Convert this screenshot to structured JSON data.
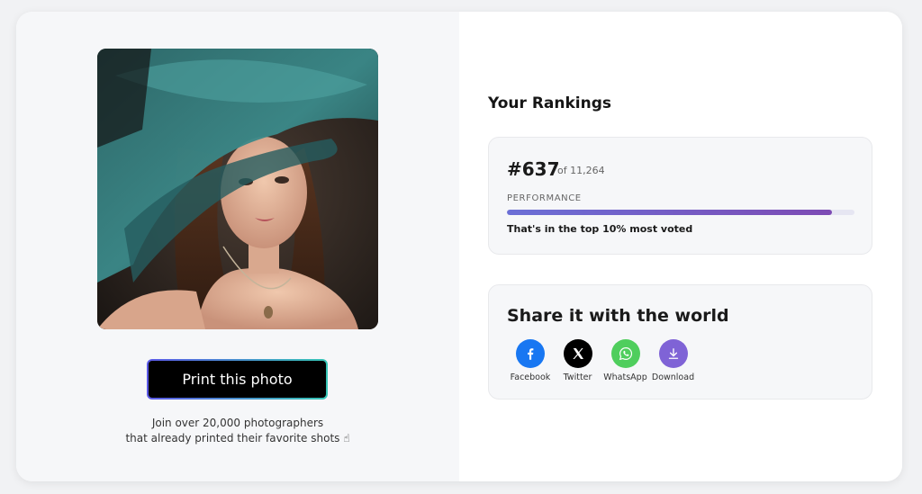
{
  "photo": {
    "alt": "Portrait of a woman wearing a teal organza hat"
  },
  "print": {
    "button_label": "Print this photo",
    "join_line1": "Join over 20,000 photographers",
    "join_line2": "that already printed their favorite shots ☝"
  },
  "rankings": {
    "title": "Your Rankings",
    "rank": "#637",
    "of_total": "of 11,264",
    "performance_label": "PERFORMANCE",
    "performance_value": 0.935,
    "caption": "That's in the top 10% most voted"
  },
  "share": {
    "title": "Share it with the world",
    "items": [
      {
        "label": "Facebook",
        "icon": "facebook-icon",
        "color": "#1877f2"
      },
      {
        "label": "Twitter",
        "icon": "x-icon",
        "color": "#000000"
      },
      {
        "label": "WhatsApp",
        "icon": "whatsapp-icon",
        "color": "#4fce5d"
      },
      {
        "label": "Download",
        "icon": "download-icon",
        "color": "#7f63d6"
      }
    ]
  },
  "colors": {
    "accent_gradient_start": "#5b58e6",
    "accent_gradient_end": "#36c5b5",
    "bar_start": "#6b6fd6",
    "bar_end": "#7d4bb4"
  }
}
